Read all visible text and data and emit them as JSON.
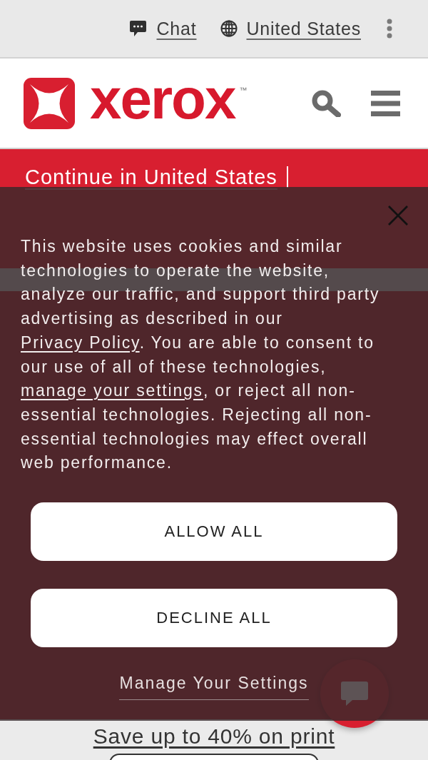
{
  "top_bar": {
    "links": [
      {
        "kind": "chat",
        "label": "Chat"
      },
      {
        "kind": "region",
        "label": "United States"
      }
    ]
  },
  "header": {
    "wordmark": "xerox",
    "trademark": "™"
  },
  "location_banner": {
    "link": "Continue in United States"
  },
  "cookie_dialog": {
    "message": [
      {
        "kind": "text",
        "text": "This website uses cookies and similar technologies to operate the website, analyze our traffic, and support third party advertising as described in our "
      },
      {
        "kind": "link",
        "text": "Privacy Policy"
      },
      {
        "kind": "text",
        "text": ". You are able to consent to our use of all of these technologies, "
      },
      {
        "kind": "link",
        "text": "manage your settings"
      },
      {
        "kind": "text",
        "text": ", or reject all non-essential technologies. Rejecting all non-essential technologies may effect overall web performance."
      }
    ],
    "buttons": [
      "ALLOW ALL",
      "DECLINE ALL"
    ],
    "manage_link": "Manage Your Settings"
  },
  "promo": {
    "link": "Save up to 40% on print"
  }
}
